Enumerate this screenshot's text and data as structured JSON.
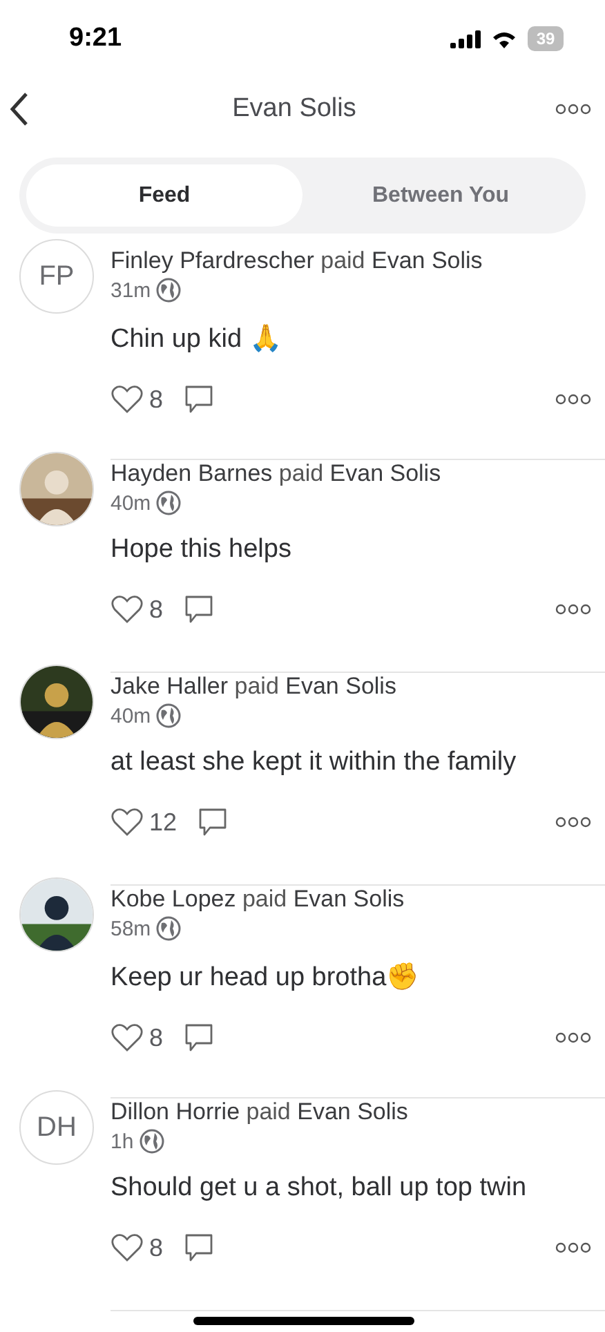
{
  "status_bar": {
    "time": "9:21",
    "battery": "39"
  },
  "nav": {
    "title": "Evan Solis"
  },
  "tabs": [
    {
      "label": "Feed",
      "selected": true
    },
    {
      "label": "Between You",
      "selected": false
    }
  ],
  "feed": [
    {
      "avatar": {
        "kind": "initials",
        "initials": "FP"
      },
      "payer": "Finley Pfardrescher",
      "verb": "paid",
      "payee": "Evan Solis",
      "time": "31m",
      "message": "Chin up kid 🙏",
      "likes": "8"
    },
    {
      "payer": "Hayden Barnes",
      "verb": "paid",
      "payee": "Evan Solis",
      "time": "40m",
      "message": "Hope this helps",
      "likes": "8"
    },
    {
      "payer": "Jake Haller",
      "verb": "paid",
      "payee": "Evan Solis",
      "time": "40m",
      "message": "at least she kept it within the family",
      "likes": "12"
    },
    {
      "payer": "Kobe Lopez",
      "verb": "paid",
      "payee": "Evan Solis",
      "time": "58m",
      "message": "Keep ur head up brotha✊",
      "likes": "8"
    },
    {
      "avatar": {
        "kind": "initials",
        "initials": "DH"
      },
      "payer": "Dillon Horrie",
      "verb": "paid",
      "payee": "Evan Solis",
      "time": "1h",
      "message": "Should get u a shot, ball up top twin",
      "likes": "8"
    }
  ]
}
